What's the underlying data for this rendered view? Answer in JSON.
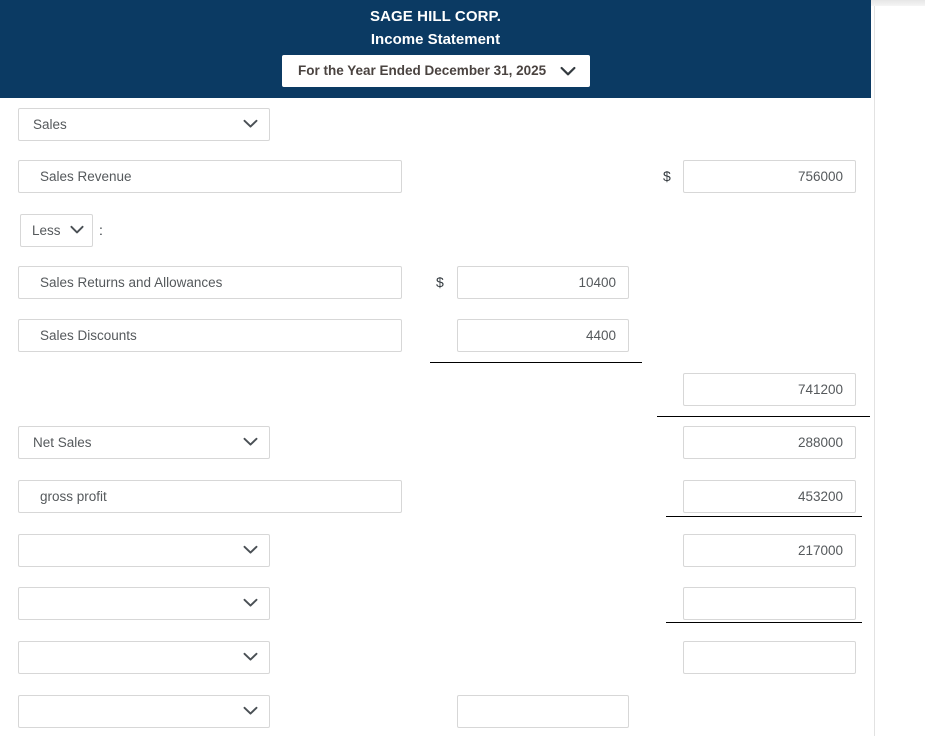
{
  "statement": {
    "company": "SAGE HILL CORP.",
    "subtitle": "Income Statement",
    "period": "For the Year Ended December 31, 2025",
    "period_caret_icon": "chevron-down-icon"
  },
  "colon_label": ":",
  "dollar_symbol": "$",
  "rows": [
    {
      "id": "row-section-sales",
      "left": {
        "kind": "select",
        "value": "Sales",
        "icon": "chevron-down-icon"
      }
    },
    {
      "id": "row-sales-revenue",
      "left": {
        "kind": "text",
        "value": "Sales Revenue"
      },
      "right": {
        "kind": "number",
        "value": "756000",
        "dollar": true
      }
    },
    {
      "id": "row-less",
      "left": {
        "kind": "select-small",
        "value": "Less",
        "icon": "chevron-down-icon",
        "suffix": ":"
      }
    },
    {
      "id": "row-sales-returns",
      "left": {
        "kind": "text",
        "value": "Sales Returns and Allowances"
      },
      "middle": {
        "kind": "number",
        "value": "10400",
        "dollar": true
      }
    },
    {
      "id": "row-sales-discounts",
      "left": {
        "kind": "text",
        "value": "Sales Discounts"
      },
      "middle": {
        "kind": "number",
        "value": "4400",
        "dollar": false,
        "rule_below": true
      }
    },
    {
      "id": "row-total-deductions",
      "right": {
        "kind": "number",
        "value": "741200",
        "dollar": false,
        "rule_below": true
      }
    },
    {
      "id": "row-net-sales",
      "left": {
        "kind": "select",
        "value": "Net Sales",
        "icon": "chevron-down-icon"
      },
      "right": {
        "kind": "number",
        "value": "288000",
        "dollar": false
      }
    },
    {
      "id": "row-gross-profit",
      "left": {
        "kind": "text",
        "value": "gross profit"
      },
      "right": {
        "kind": "number",
        "value": "453200",
        "dollar": false,
        "rule_below": true
      }
    },
    {
      "id": "row-blank-1",
      "left": {
        "kind": "select",
        "value": "",
        "icon": "chevron-down-icon"
      },
      "right": {
        "kind": "number",
        "value": "217000",
        "dollar": false
      }
    },
    {
      "id": "row-blank-2",
      "left": {
        "kind": "select",
        "value": "",
        "icon": "chevron-down-icon"
      },
      "right": {
        "kind": "number",
        "value": "",
        "dollar": false,
        "rule_below": true
      }
    },
    {
      "id": "row-blank-3",
      "left": {
        "kind": "select",
        "value": "",
        "icon": "chevron-down-icon"
      },
      "right": {
        "kind": "number",
        "value": "",
        "dollar": false
      }
    },
    {
      "id": "row-blank-4",
      "left": {
        "kind": "select",
        "value": "",
        "icon": "chevron-down-icon"
      },
      "middle": {
        "kind": "number",
        "value": "",
        "dollar": false
      }
    }
  ]
}
